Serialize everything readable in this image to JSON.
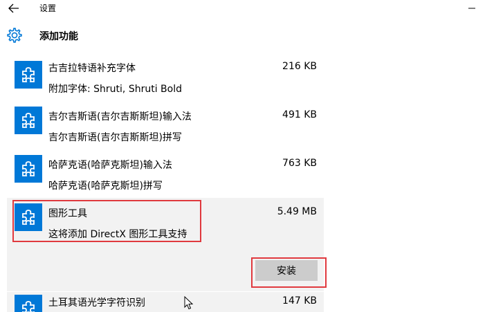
{
  "window": {
    "title": "设置"
  },
  "header": {
    "title": "添加功能"
  },
  "features": [
    {
      "name": "古吉拉特语补充字体",
      "description": "附加字体: Shruti, Shruti Bold",
      "size": "216 KB"
    },
    {
      "name": "吉尔吉斯语(吉尔吉斯斯坦)输入法",
      "description": "吉尔吉斯语(吉尔吉斯斯坦)拼写",
      "size": "491 KB"
    },
    {
      "name": "哈萨克语(哈萨克斯坦)输入法",
      "description": "哈萨克语(哈萨克斯坦)拼写",
      "size": "763 KB"
    },
    {
      "name": "图形工具",
      "description": "这将添加 DirectX 图形工具支持",
      "size": "5.49 MB",
      "install_label": "安装",
      "selected": true
    },
    {
      "name": "土耳其语光学字符识别",
      "size": "147 KB"
    }
  ],
  "colors": {
    "accent": "#0078d7",
    "selected_background": "#f2f2f2",
    "install_button": "#cccccc",
    "highlight": "#e0393e"
  },
  "icons": {
    "back": "arrow-left-icon",
    "minimize": "minimize-icon",
    "header": "gear-icon",
    "feature": "puzzle-piece-icon"
  }
}
